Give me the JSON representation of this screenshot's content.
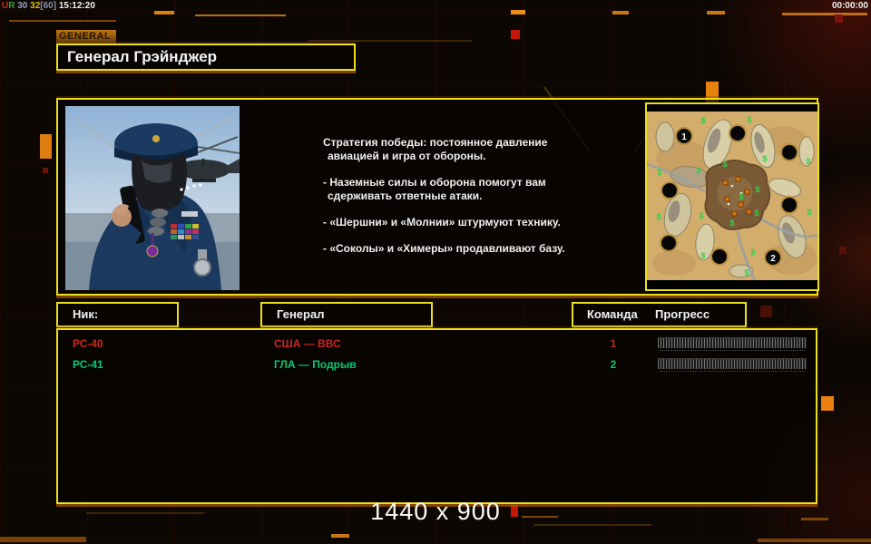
{
  "colors": {
    "accent_yellow": "#ecdf1b",
    "accent_orange": "#c96a00",
    "red_player": "#c8281e",
    "green_player": "#00cb72"
  },
  "perf": {
    "segments": [
      {
        "text": "U",
        "color": "#c83214"
      },
      {
        "text": "R",
        "color": "#3aa03c"
      },
      {
        "text": " 30",
        "color": "#9aa4c8"
      },
      {
        "text": " 32",
        "color": "#d8bc1e"
      },
      {
        "text": "[60]",
        "color": "#8a92a8"
      },
      {
        "text": " 15:12:20",
        "color": "#f2f2f2"
      }
    ]
  },
  "window": {
    "timer": "00:00:00",
    "resolution_label": "1440 x 900"
  },
  "tab": {
    "label": "GENERAL"
  },
  "page": {
    "title": "Генерал Грэйнджер"
  },
  "strategy": {
    "lines": [
      "Стратегия победы: постоянное давление",
      "авиацией и игра от обороны.",
      "- Наземные силы и оборона помогут вам",
      "сдерживать ответные атаки.",
      "- «Шершни» и «Молнии» штурмуют технику.",
      "- «Соколы» и «Химеры» продавливают базу."
    ]
  },
  "minimap": {
    "supply_symbol": "$",
    "spawns": [
      {
        "label": "1"
      },
      {
        "label": "2"
      }
    ]
  },
  "roster": {
    "headers": {
      "nick": "Ник:",
      "general": "Генерал",
      "team": "Команда",
      "progress": "Прогресс"
    },
    "rows": [
      {
        "nick": "РС-40",
        "general": "США — ВВС",
        "team": "1",
        "color": "#c8281e"
      },
      {
        "nick": "РС-41",
        "general": "ГЛА — Подрыв",
        "team": "2",
        "color": "#00cb72"
      }
    ]
  }
}
